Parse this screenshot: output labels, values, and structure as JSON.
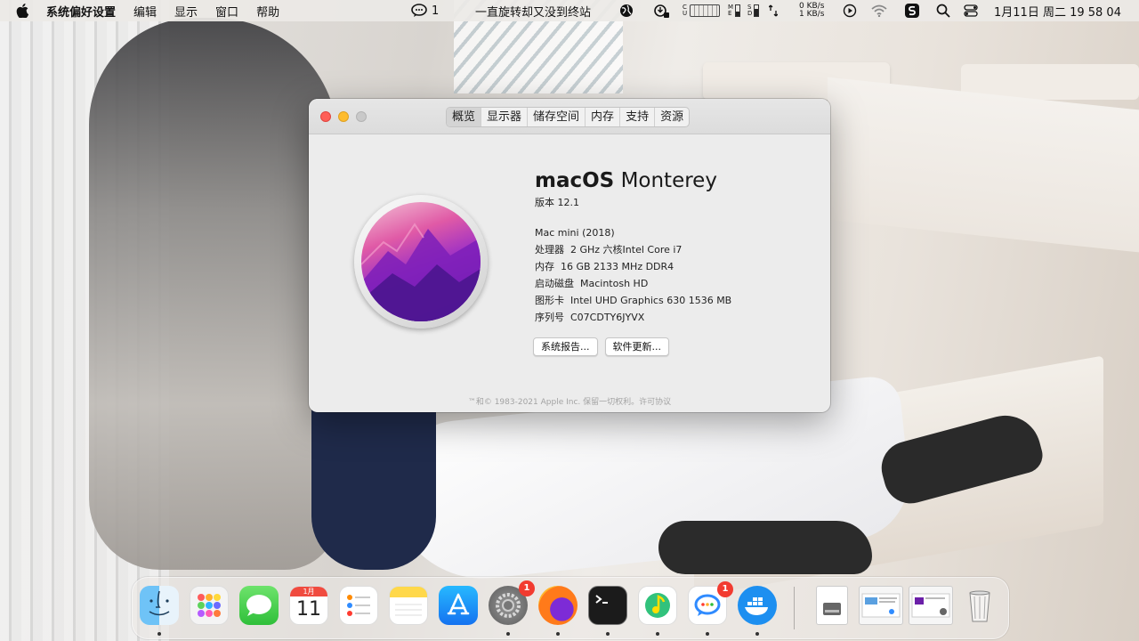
{
  "menubar": {
    "app_name": "系统偏好设置",
    "menus": [
      "编辑",
      "显示",
      "窗口",
      "帮助"
    ],
    "chat_badge": "1",
    "marquee": "一直旋转却又没到终站",
    "net_up": "0 KB/s",
    "net_down": "1 KB/s",
    "datetime": "1月11日 周二  19 58 04",
    "stat_labels": [
      "C",
      "U"
    ],
    "mem_labels": [
      "M",
      "E"
    ],
    "disk_labels": [
      "S",
      "D"
    ],
    "gpu_labels": [
      "G",
      "P"
    ]
  },
  "about": {
    "tabs": [
      "概览",
      "显示器",
      "储存空间",
      "内存",
      "支持",
      "资源"
    ],
    "active_tab": 0,
    "os_bold": "macOS",
    "os_name": "Monterey",
    "version": "版本 12.1",
    "model": "Mac mini (2018)",
    "specs": [
      {
        "key": "处理器",
        "value": "2 GHz 六核Intel Core i7"
      },
      {
        "key": "内存",
        "value": "16 GB 2133 MHz DDR4"
      },
      {
        "key": "启动磁盘",
        "value": "Macintosh HD"
      },
      {
        "key": "图形卡",
        "value": "Intel UHD Graphics 630 1536 MB"
      },
      {
        "key": "序列号",
        "value": "C07CDTY6JYVX"
      }
    ],
    "report_button": "系统报告...",
    "update_button": "软件更新...",
    "footer": "™和© 1983-2021 Apple Inc. 保留一切权利。许可协议"
  },
  "dock": {
    "calendar_month": "1月",
    "calendar_day": "11",
    "settings_badge": "1",
    "qq_badge": "1"
  }
}
